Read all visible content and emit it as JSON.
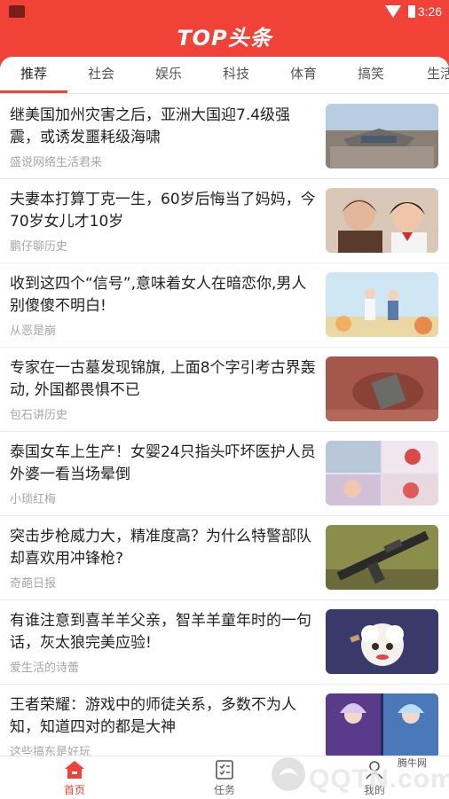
{
  "status": {
    "time": "3:26"
  },
  "app": {
    "title": "TOP头条",
    "accent": "#f04237"
  },
  "tabs": [
    {
      "label": "推荐",
      "active": true
    },
    {
      "label": "社会"
    },
    {
      "label": "娱乐"
    },
    {
      "label": "科技"
    },
    {
      "label": "体育"
    },
    {
      "label": "搞笑"
    },
    {
      "label": "生活"
    }
  ],
  "feed": [
    {
      "title": "继美国加州灾害之后，亚洲大国迎7.4级强震，或诱发噩耗级海啸",
      "source": "盛说网络生活君来",
      "thumb": "earthquake-ruins"
    },
    {
      "title": "夫妻本打算丁克一生，60岁后悔当了妈妈，今70岁女儿才10岁",
      "source": "鹏仔聊历史",
      "thumb": "mother-and-daughter"
    },
    {
      "title": "收到这四个“信号”,意味着女人在暗恋你,男人别傻傻不明白!",
      "source": "从恶是崩",
      "thumb": "couple-illustration"
    },
    {
      "title": "专家在一古墓发现锦旗, 上面8个字引考古界轰动, 外国都畏惧不已",
      "source": "包石讲历史",
      "thumb": "tomb-excavation"
    },
    {
      "title": "泰国女车上生产！女婴24只指头吓坏医护人员 外婆一看当场晕倒",
      "source": "小琐红梅",
      "thumb": "newborn-collage"
    },
    {
      "title": "突击步枪威力大，精准度高？为什么特警部队却喜欢用冲锋枪?",
      "source": "奇葩日报",
      "thumb": "rifle"
    },
    {
      "title": "有谁注意到喜羊羊父亲，智羊羊童年时的一句话，灰太狼完美应验!",
      "source": "爱生活的诗蕾",
      "thumb": "cartoon-sheep"
    },
    {
      "title": "王者荣耀：游戏中的师徒关系，多数不为人知，知道四对的都是大神",
      "source": "这些搞东是好玩",
      "thumb": "game-heroes"
    }
  ],
  "bottom_nav": [
    {
      "label": "首页",
      "icon": "home-icon",
      "active": true
    },
    {
      "label": "任务",
      "icon": "task-icon"
    },
    {
      "label": "我的",
      "icon": "user-icon"
    }
  ],
  "watermark": {
    "text": "QQTN.com",
    "small": "腾牛网"
  }
}
